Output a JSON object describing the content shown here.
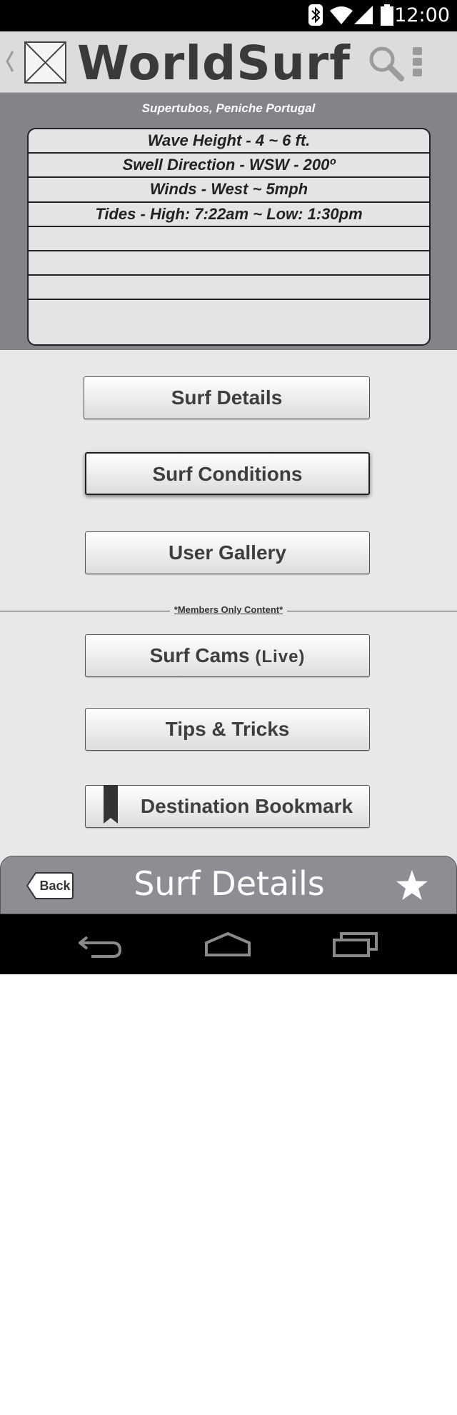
{
  "status_bar": {
    "time": "12:00",
    "icons": [
      "bluetooth-icon",
      "wifi-icon",
      "signal-icon",
      "battery-icon"
    ]
  },
  "action_bar": {
    "title": "WorldSurf",
    "icons": [
      "back-chevron-icon",
      "image-placeholder-icon",
      "search-icon",
      "overflow-menu-icon"
    ]
  },
  "conditions": {
    "location": "Supertubos, Peniche Portugal",
    "rows": [
      "Wave Height - 4 ~ 6 ft.",
      "Swell Direction - WSW - 200º",
      "Winds - West ~ 5mph",
      "Tides - High: 7:22am ~  Low: 1:30pm",
      "",
      "",
      "",
      ""
    ]
  },
  "menu": {
    "surf_details": "Surf Details",
    "surf_conditions": "Surf Conditions",
    "user_gallery": "User Gallery",
    "members_label": "*Members Only Content*",
    "surf_cams": "Surf Cams",
    "surf_cams_tag": "(Live)",
    "tips_tricks": "Tips & Tricks",
    "destination_bookmark": "Destination Bookmark",
    "selected": "surf_conditions"
  },
  "bottom_bar": {
    "back_label": "Back",
    "title": "Surf Details",
    "icons": [
      "star-icon"
    ]
  },
  "nav_bar": {
    "icons": [
      "nav-back-icon",
      "nav-home-icon",
      "nav-recents-icon"
    ]
  },
  "colors": {
    "status_bar": "#000000",
    "action_bar": "#dcdcdc",
    "panel": "#838489",
    "background": "#e8e8e8",
    "bottom_bar": "#8d8e93",
    "text": "#3e3e3e"
  }
}
